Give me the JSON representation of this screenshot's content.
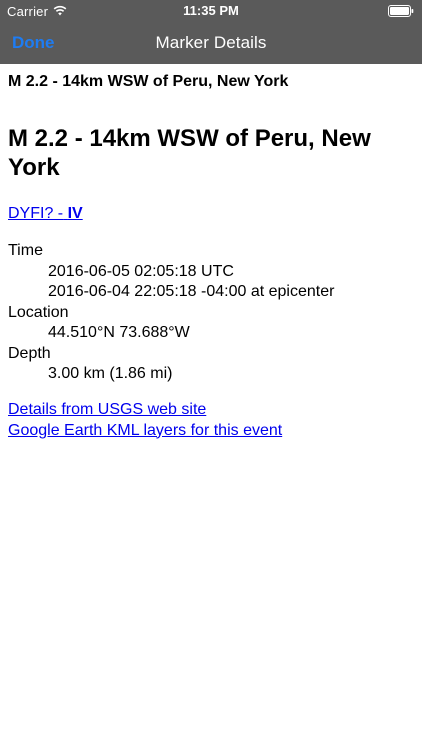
{
  "status_bar": {
    "carrier": "Carrier",
    "time": "11:35 PM"
  },
  "nav": {
    "done_label": "Done",
    "title": "Marker Details"
  },
  "event": {
    "short_title": "M 2.2 - 14km WSW of Peru, New York",
    "title": "M 2.2 - 14km WSW of Peru, New York",
    "dyfi_prefix": "DYFI? -",
    "dyfi_intensity": "IV",
    "time_label": "Time",
    "time_utc": "2016-06-05 02:05:18 UTC",
    "time_local": "2016-06-04 22:05:18 -04:00 at epicenter",
    "location_label": "Location",
    "location_value": "44.510°N 73.688°W",
    "depth_label": "Depth",
    "depth_value": "3.00 km (1.86 mi)"
  },
  "links": {
    "usgs": "Details from USGS web site",
    "kml": "Google Earth KML layers for this event"
  },
  "colors": {
    "bar_background": "#5a5a5a",
    "done_blue": "#1e7cf2",
    "link_blue": "#0000ee"
  }
}
